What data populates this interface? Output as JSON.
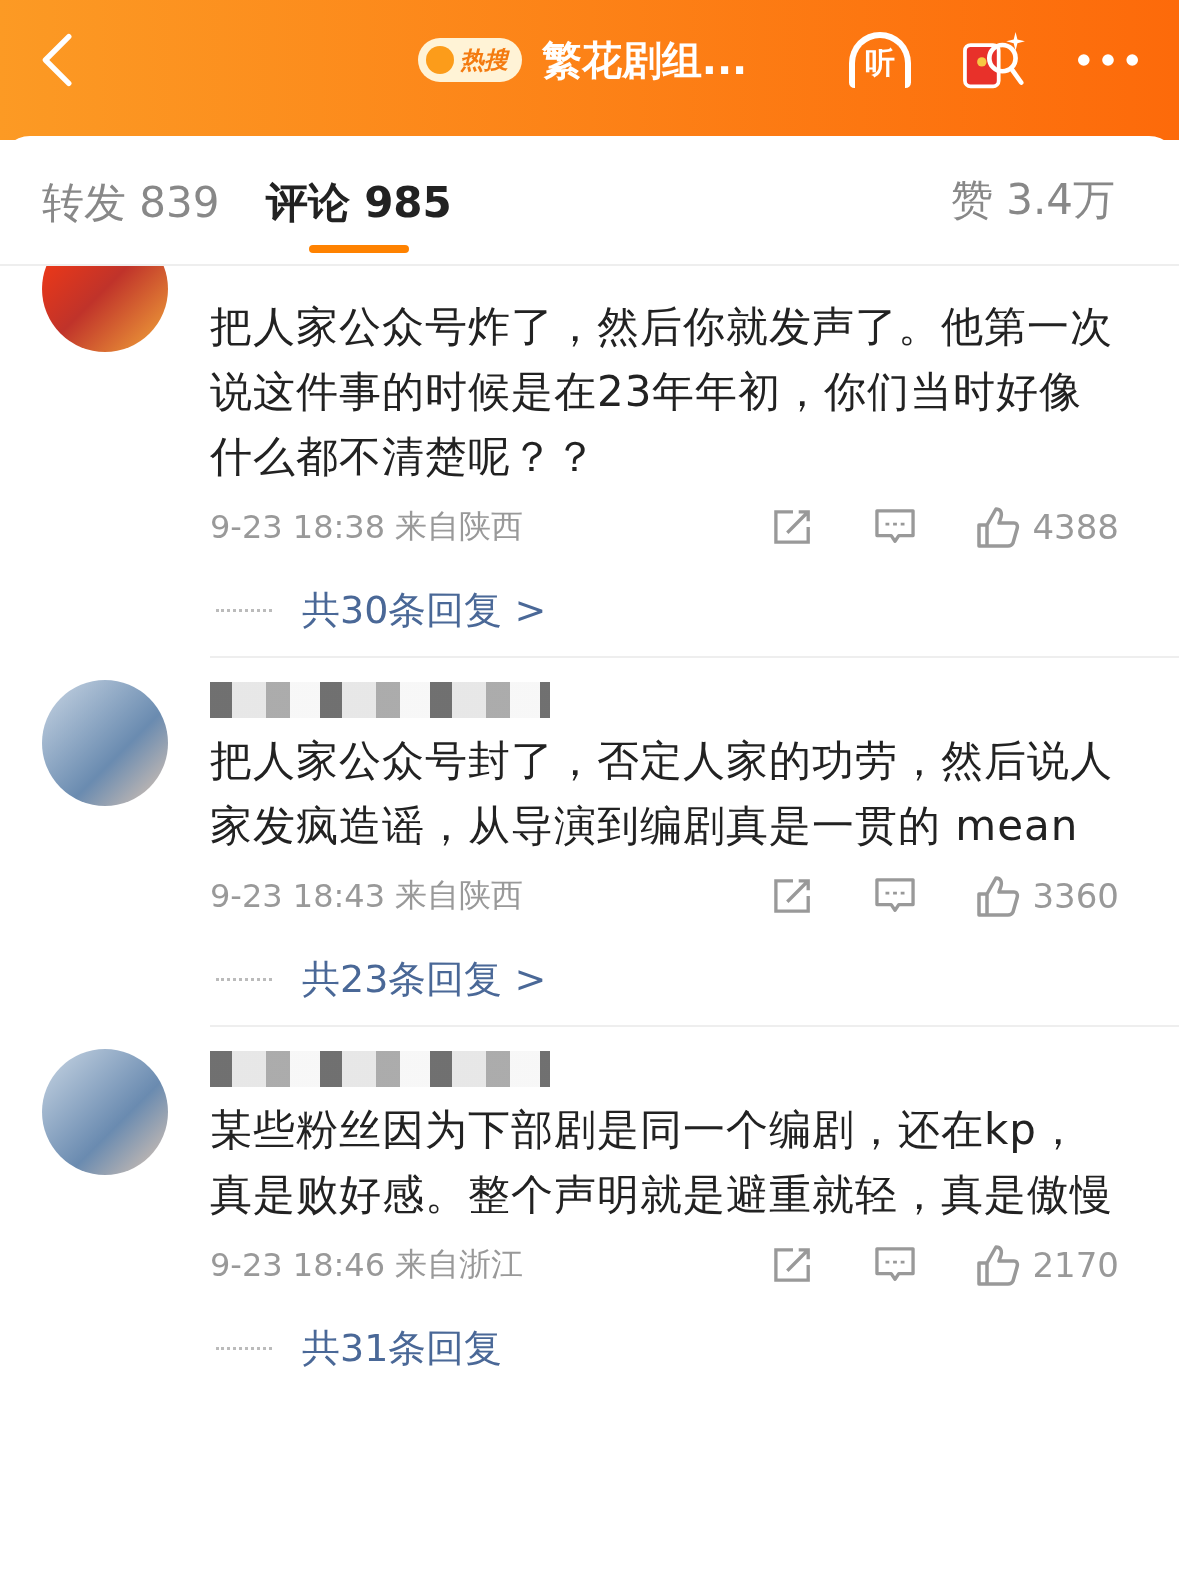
{
  "header": {
    "hot_badge": "热搜",
    "title": "繁花剧组...",
    "listen_label": "听"
  },
  "tabs": [
    {
      "label": "转发 839",
      "selected": false
    },
    {
      "label": "评论 985",
      "selected": true
    }
  ],
  "likes_total": "赞 3.4万",
  "comments": [
    {
      "avatar_cut": true,
      "text": "把人家公众号炸了，然后你就发声了。他第一次说这件事的时候是在23年年初，你们当时好像什么都不清楚呢？？",
      "time": "9-23 18:38",
      "location": "来自陕西",
      "likes": "4388",
      "replies": "共30条回复 >"
    },
    {
      "avatar_cut": false,
      "text": "把人家公众号封了，否定人家的功劳，然后说人家发疯造谣，从导演到编剧真是一贯的 mean",
      "time": "9-23 18:43",
      "location": "来自陕西",
      "likes": "3360",
      "replies": "共23条回复 >"
    },
    {
      "avatar_cut": false,
      "text": "某些粉丝因为下部剧是同一个编剧，还在kp，真是败好感。整个声明就是避重就轻，真是傲慢",
      "time": "9-23 18:46",
      "location": "来自浙江",
      "likes": "2170",
      "replies": "共31条回复"
    }
  ]
}
